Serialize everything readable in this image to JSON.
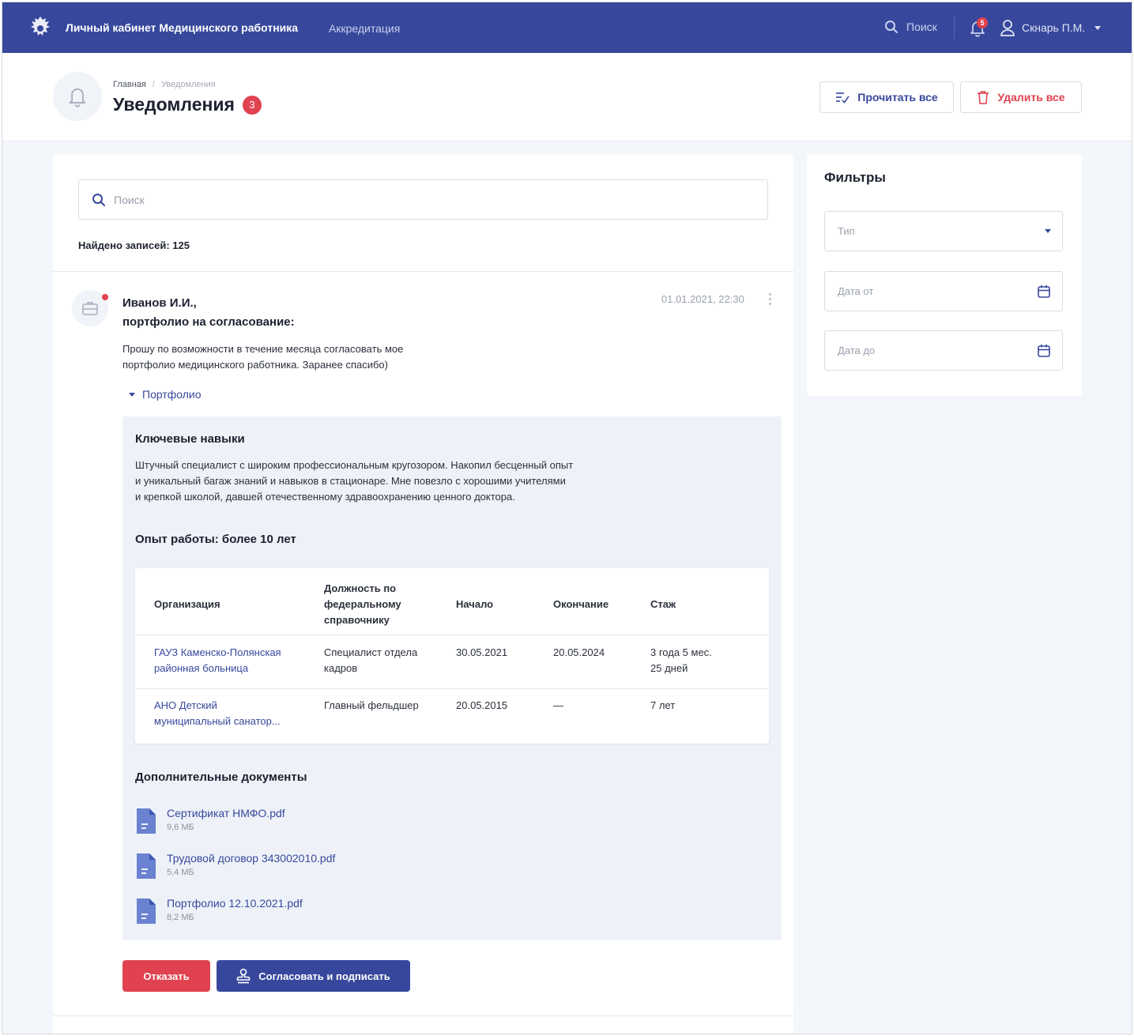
{
  "topbar": {
    "app_title": "Личный кабинет Медицинского работника",
    "nav_accreditation": "Аккредитация",
    "search_label": "Поиск",
    "notifications_count": "5",
    "user_name": "Скнарь П.М."
  },
  "header": {
    "breadcrumb": [
      "Главная",
      "/",
      "Уведомления"
    ],
    "title": "Уведомления",
    "badge": "3",
    "read_all": "Прочитать все",
    "delete_all": "Удалить все"
  },
  "search": {
    "placeholder": "Поиск"
  },
  "found": "Найдено записей: 125",
  "message": {
    "author": "Иванов И.И.,",
    "subject": "портфолио на согласование:",
    "date": "01.01.2021, 22:30",
    "text_line1": "Прошу по возможности в течение месяца согласовать мое",
    "text_line2": "портфолио медицинского работника. Заранее спасибо)",
    "portfolio_toggle": "Портфолио"
  },
  "portfolio": {
    "skills_title": "Ключевые навыки",
    "skills_lines": [
      "Штучный специалист с широким профессиональным кругозором. Накопил бесценный опыт",
      "и уникальный багаж знаний и навыков в стационаре. Мне повезло с хорошими учителями",
      "и крепкой школой, давшей отечественному здравоохранению ценного доктора."
    ],
    "experience_title": "Опыт работы: более 10 лет",
    "table": {
      "headers": {
        "org": "Организация",
        "position_lines": [
          "Должность по",
          "федеральному",
          "справочнику"
        ],
        "start": "Начало",
        "end": "Окончание",
        "tenure": "Стаж"
      },
      "rows": [
        {
          "org_lines": [
            "ГАУЗ Каменско-Полянская",
            "районная больница"
          ],
          "position_lines": [
            "Специалист отдела",
            "кадров"
          ],
          "start": "30.05.2021",
          "end": "20.05.2024",
          "tenure_lines": [
            "3 года 5 мес.",
            "25 дней"
          ]
        },
        {
          "org_lines": [
            "АНО Детский",
            "муниципальный санатор..."
          ],
          "position_lines": [
            "Главный фельдшер"
          ],
          "start": "20.05.2015",
          "end": "—",
          "tenure_lines": [
            "7 лет"
          ]
        }
      ]
    },
    "docs_title": "Дополнительные документы",
    "docs": [
      {
        "name": "Сертификат НМФО.pdf",
        "size": "9,6 МБ"
      },
      {
        "name": "Трудовой договор 343002010.pdf",
        "size": "5,4 МБ"
      },
      {
        "name": "Портфолио 12.10.2021.pdf",
        "size": "8,2 МБ"
      }
    ]
  },
  "actions": {
    "reject": "Отказать",
    "approve": "Согласовать и подписать"
  },
  "filters": {
    "title": "Фильтры",
    "type_placeholder": "Тип",
    "date_from_placeholder": "Дата от",
    "date_to_placeholder": "Дата до"
  },
  "colors": {
    "brand": "#37489c",
    "danger": "#e0424f",
    "panel_bg": "#eef2f8"
  },
  "icons": [
    "emblem-icon",
    "search-icon",
    "bell-icon",
    "user-icon",
    "checklist-icon",
    "trash-icon",
    "briefcase-icon",
    "file-icon",
    "stamp-icon",
    "calendar-icon"
  ]
}
